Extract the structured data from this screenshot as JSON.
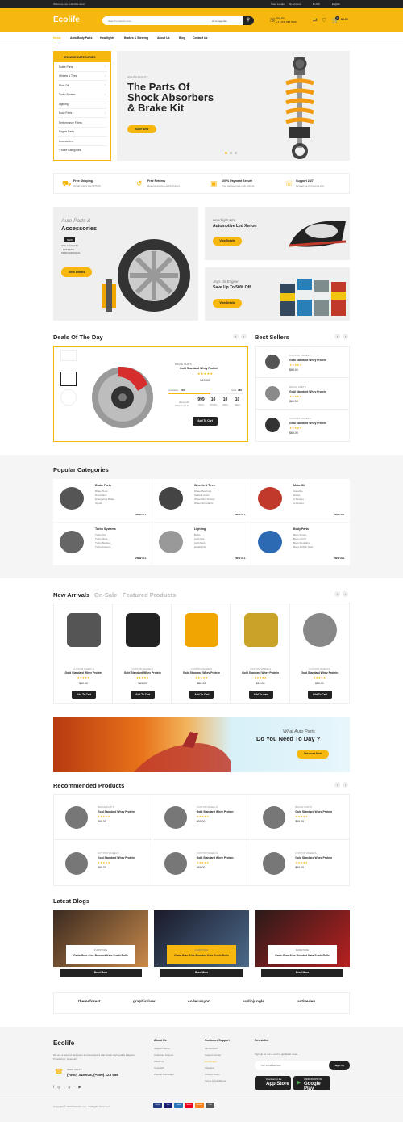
{
  "topbar": {
    "welcome": "Welcome you to Ecolife store!",
    "links": [
      "Store Locator",
      "My Account",
      "$ USD",
      "English"
    ]
  },
  "header": {
    "logo": "Ecolife",
    "search_placeholder": "Search products here...",
    "category_select": "All Categories",
    "call_label": "Call Us:",
    "call_number": "+1 (123) 888 9999",
    "cart_total": "$0.00",
    "cart_count": "0"
  },
  "nav": [
    "Home",
    "Auto Body Parts",
    "Headlights",
    "Brakes & Steering",
    "About Us",
    "Blog",
    "Contact Us"
  ],
  "browse": {
    "title": "BROWSE CATEGORIES",
    "items": [
      "Brake Parts",
      "Wheels & Tires",
      "Moto Oil",
      "Turbo System",
      "Lighting",
      "Body Parts",
      "Performance Filters",
      "Engine Parts",
      "Accessories",
      "+ More Categories"
    ]
  },
  "hero": {
    "kicker": "HIGHT & QUALITY",
    "title": [
      "The Parts Of",
      "Shock Absorbers",
      "& Brake Kit"
    ],
    "cta": "SHOP NOW"
  },
  "services": [
    {
      "title": "Free Shipping",
      "sub": "On all orders over $75.00"
    },
    {
      "title": "Free Returns",
      "sub": "Returns are free within 9 days"
    },
    {
      "title": "100% Payment Secure",
      "sub": "Your payment are safe with us."
    },
    {
      "title": "Support 24/7",
      "sub": "Contact us 24 hours a day"
    }
  ],
  "banners": {
    "big": {
      "kicker": "Auto Parts &",
      "title": "Accessories",
      "badge": "NEW",
      "lines": [
        "HIGH QUALITY",
        "- EXTREME",
        "PERFORMANCE"
      ],
      "cta": "View Details"
    },
    "top": {
      "kicker": "Headlight Kits",
      "title": "Automotive Led Xenon",
      "cta": "View Details"
    },
    "bottom": {
      "kicker": "Jegs Oil Engine",
      "title": "Save Up To 50% Off",
      "cta": "View Details"
    }
  },
  "deals": {
    "title": "Deals Of The Day",
    "category": "BRAKE PARTS",
    "name": "Gold Standard Whey Protein",
    "price": "$69.00",
    "available_label": "Available:",
    "available": "616",
    "sold_label": "Sold:",
    "sold": "780",
    "hurry": [
      "Hurry Up!",
      "Offer ends in:"
    ],
    "countdown": [
      {
        "v": "999",
        "l": "DAYS"
      },
      {
        "v": "10",
        "l": "HOURS"
      },
      {
        "v": "10",
        "l": "MINS"
      },
      {
        "v": "10",
        "l": "SECS"
      }
    ],
    "cta": "Add To Cart"
  },
  "best_sellers": {
    "title": "Best Sellers",
    "items": [
      {
        "cat": "CUSTOM WHEELS",
        "name": "Gold Standard Whey Protein",
        "price": "$69.00"
      },
      {
        "cat": "BRAKE PARTS",
        "name": "Gold Standard Whey Protein",
        "price": "$69.00"
      },
      {
        "cat": "CUSTOM WHEELS",
        "name": "Gold Standard Whey Protein",
        "price": "$69.00"
      }
    ]
  },
  "popular": {
    "title": "Popular Categories",
    "view_all": "VIEW ALL",
    "items": [
      {
        "name": "Brake Parts",
        "subs": [
          "Brake Tools",
          "Drivetrains",
          "Emergency Brake",
          "Spoilts"
        ]
      },
      {
        "name": "Wheels & Tires",
        "subs": [
          "Wheel Bearings",
          "Seats & Axles",
          "Wheel Rim Screws",
          "Wheel Simulators"
        ]
      },
      {
        "name": "Moto Oil",
        "subs": [
          "Gasoline",
          "Diesel",
          "2-Strokes",
          "4-Strokes"
        ]
      },
      {
        "name": "Turbo Systems",
        "subs": [
          "Turbo Kits",
          "Turbo Wrap",
          "Turbo Blanket",
          "Turbochargers"
        ]
      },
      {
        "name": "Lighting",
        "subs": [
          "Bulbs",
          "Light Kits",
          "Light Bars",
          "Headlights"
        ]
      },
      {
        "name": "Body Parts",
        "subs": [
          "Body Mount",
          "Body Lift Kit",
          "Body Moulding",
          "Body & Pillar Seal"
        ]
      }
    ]
  },
  "new_arrivals": {
    "tabs": [
      "New Arrivals",
      "On-Sale",
      "Featured Products"
    ],
    "cat": "CUSTOM WHEELS",
    "name": "Gold Standard Whey Protein",
    "price": "$69.00",
    "cta": "Add To Cart"
  },
  "promo": {
    "kicker": "What Auto Parts",
    "title": "Do You Need To Day ?",
    "cta": "Discover Now"
  },
  "recommended": {
    "title": "Recommended Products",
    "items": [
      {
        "cat": "BRAKE PARTS",
        "name": "Gold Standard Whey Protein",
        "price": "$69.00"
      },
      {
        "cat": "CUSTOM WHEELS",
        "name": "Gold Standard Whey Protein",
        "price": "$69.00"
      },
      {
        "cat": "BRAKE PARTS",
        "name": "Gold Standard Whey Protein",
        "price": "$69.00"
      },
      {
        "cat": "CUSTOM WHEELS",
        "name": "Gold Standard Whey Protein",
        "price": "$69.00"
      },
      {
        "cat": "CUSTOM WHEELS",
        "name": "Gold Standard Whey Protein",
        "price": "$69.00"
      },
      {
        "cat": "CUSTOM WHEELS",
        "name": "Gold Standard Whey Protein",
        "price": "$69.00"
      }
    ]
  },
  "blogs": {
    "title": "Latest Blogs",
    "cat": "FURNITURE",
    "name": "Grain-Free Aloe-Boosted Kate Sushi Rolls",
    "cta": "Read More"
  },
  "brands": [
    "themeforest",
    "graphicriver",
    "codecanyon",
    "audiojungle",
    "activeden"
  ],
  "footer": {
    "logo": "Ecolife",
    "about": "We are a team of designers and developers that create high quality Magento, Prestashop, Opencart.",
    "need_help": "NEED HELP?",
    "phones": "(+800) 345 678, (+800) 123 456",
    "about_title": "About Us",
    "about_links": [
      "Support Center",
      "Customer Support",
      "About Us",
      "Copyright",
      "Popular Campaign"
    ],
    "support_title": "Customer Support",
    "support_links": [
      "My Account",
      "Support Center",
      "Exchanges",
      "Shipping",
      "Privacy Policy",
      "Terms & Conditions"
    ],
    "news_title": "Newsletter",
    "news_text": "Sign up for our e-mail to get latest news.",
    "news_placeholder": "Your email address",
    "news_btn": "Sign Up",
    "app_store": "App Store",
    "google_play": "Google Play",
    "app_small": "Download on the",
    "gp_small": "ANDROID APP ON",
    "copyright": "Copyright © 2020 Plazathemes. All Rights Reserved.",
    "payments": [
      "PayPal",
      "Visa",
      "Amex",
      "Master",
      "Discover",
      "Card"
    ]
  },
  "colors": {
    "accent": "#f6b70e",
    "dark": "#222222"
  }
}
